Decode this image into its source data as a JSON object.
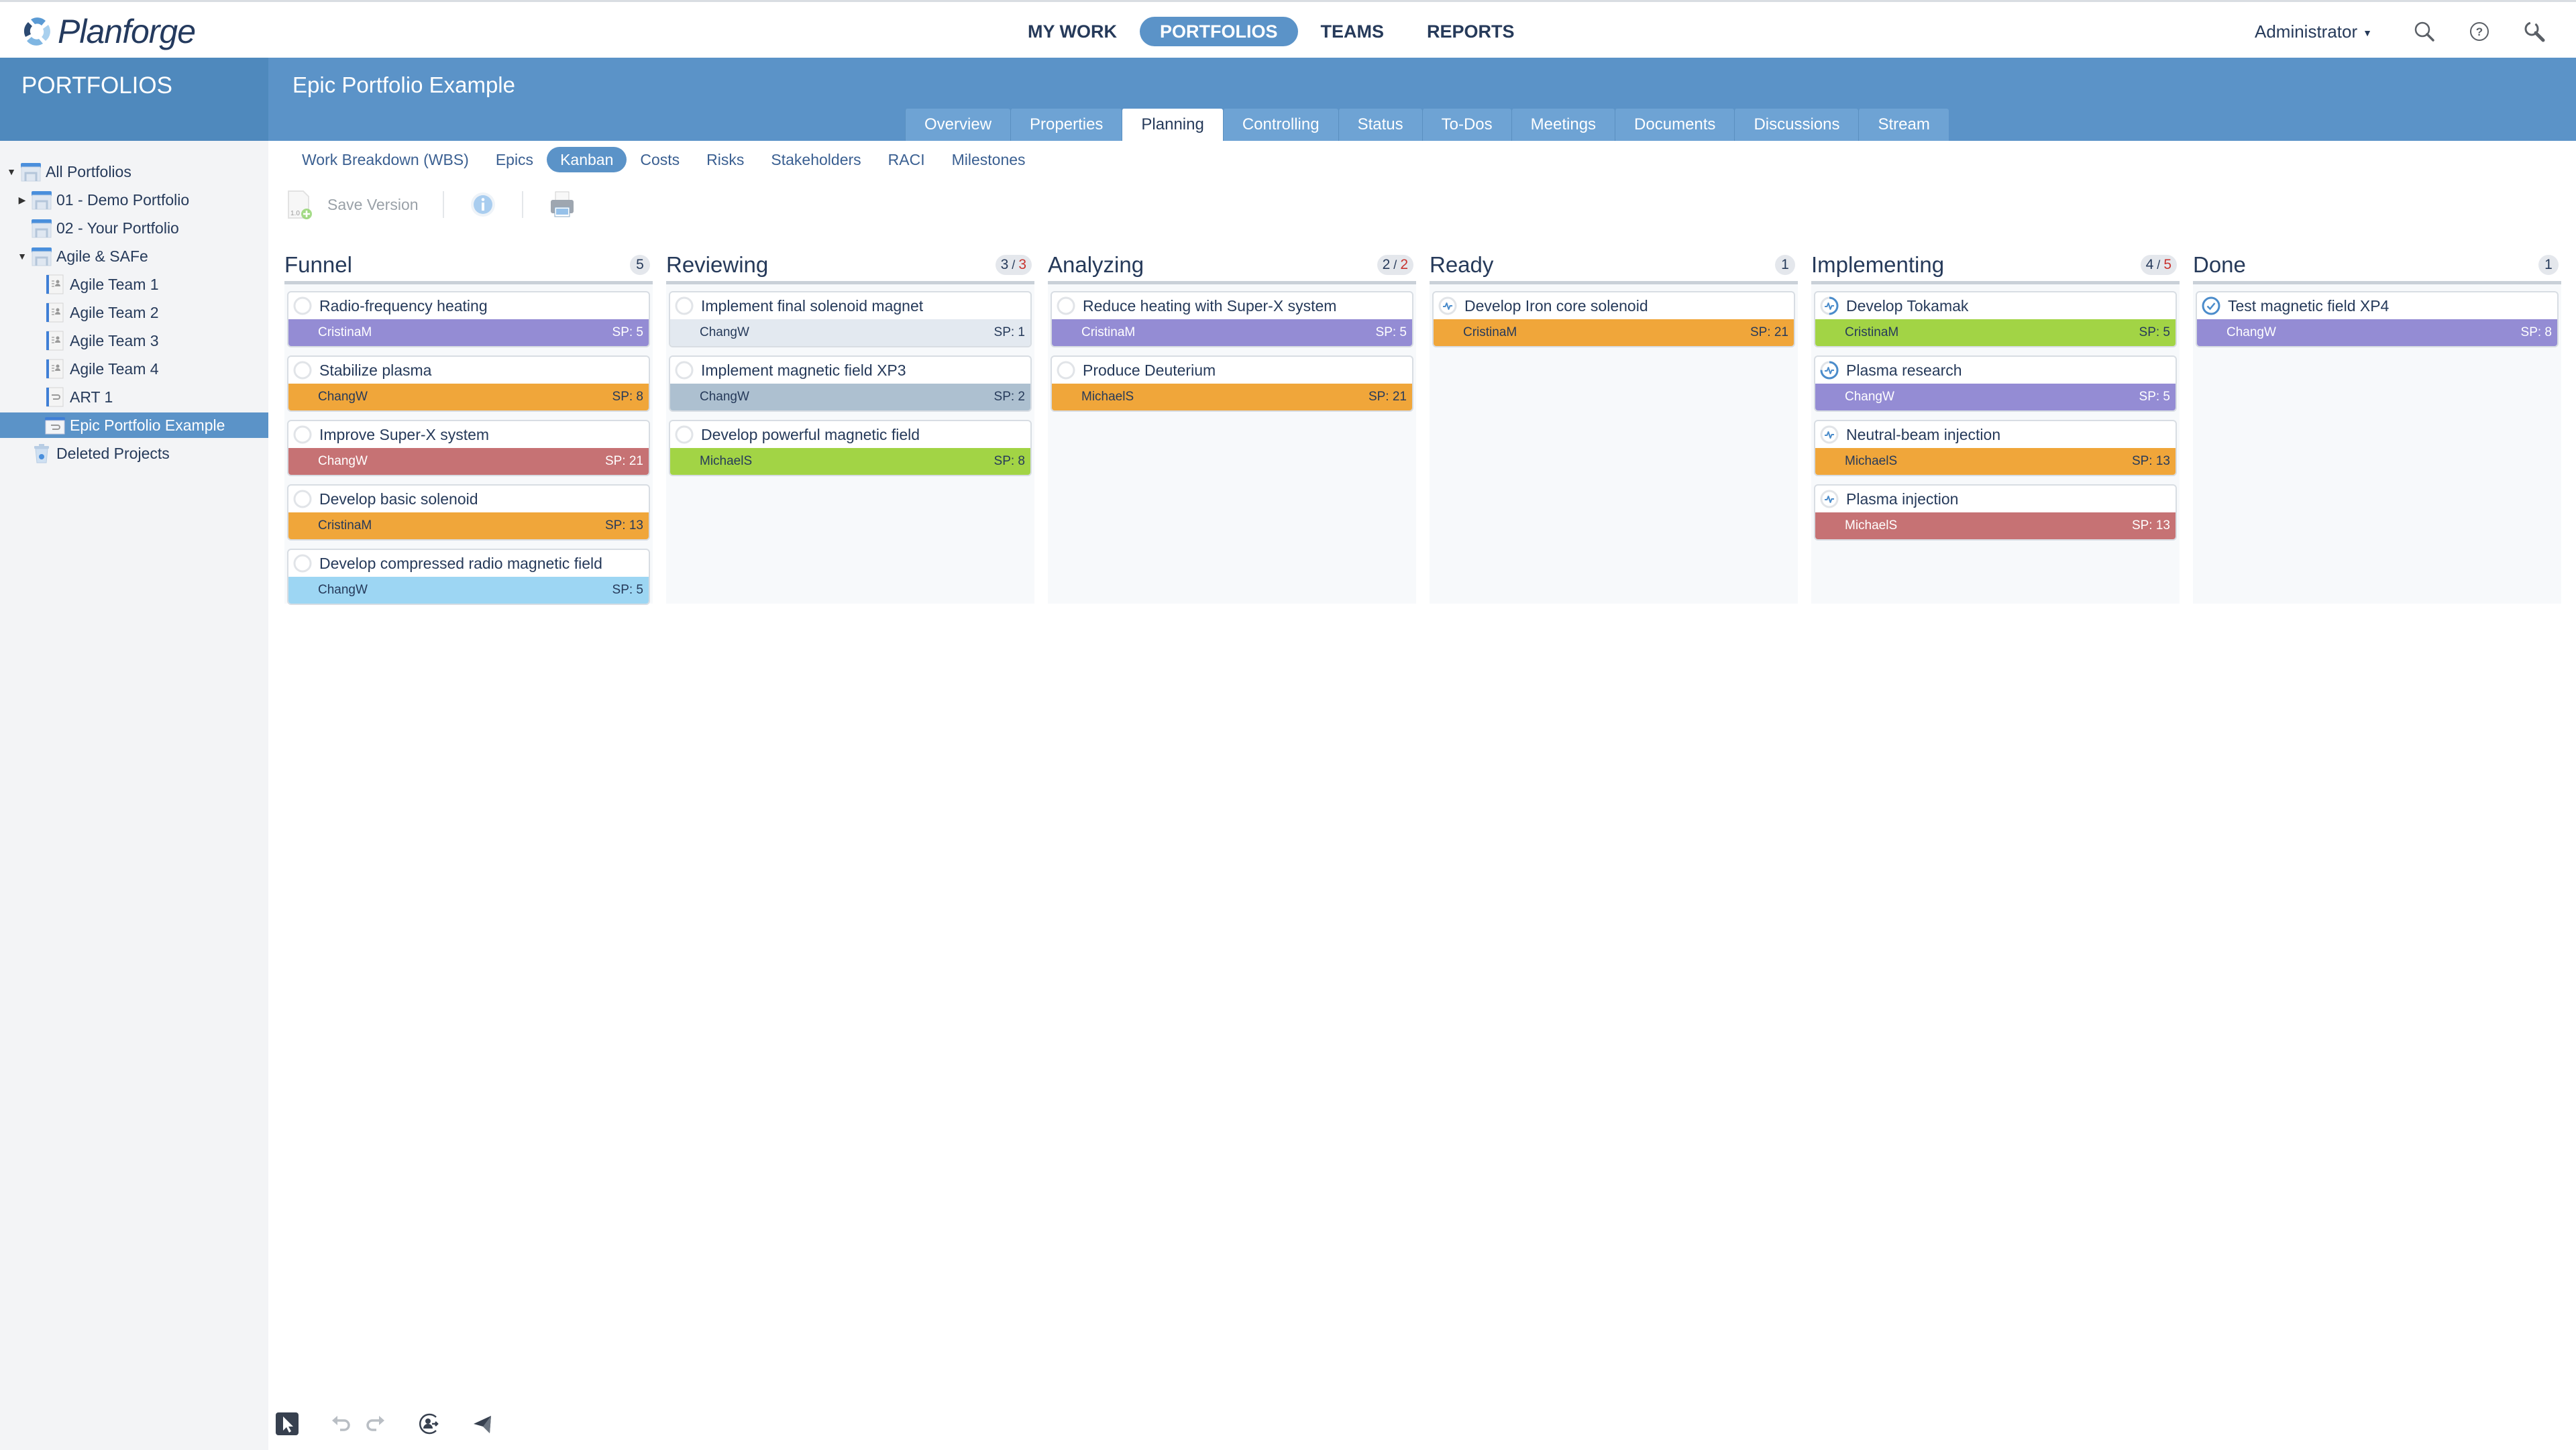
{
  "app": {
    "logo_text": "Planforge",
    "nav": [
      {
        "label": "MY WORK",
        "active": false
      },
      {
        "label": "PORTFOLIOS",
        "active": true
      },
      {
        "label": "TEAMS",
        "active": false
      },
      {
        "label": "REPORTS",
        "active": false
      }
    ],
    "user_label": "Administrator",
    "icons": [
      "search-icon",
      "help-icon",
      "settings-wrench-icon"
    ]
  },
  "sidebar": {
    "title": "PORTFOLIOS",
    "items": [
      {
        "label": "All Portfolios",
        "level": 0,
        "toggle": "expanded",
        "icon": "portfolio-folder-icon",
        "selected": false
      },
      {
        "label": "01 - Demo Portfolio",
        "level": 1,
        "toggle": "collapsed",
        "icon": "portfolio-folder-icon",
        "selected": false
      },
      {
        "label": "02 - Your Portfolio",
        "level": 1,
        "toggle": "none",
        "icon": "portfolio-folder-icon",
        "selected": false
      },
      {
        "label": "Agile & SAFe",
        "level": 1,
        "toggle": "expanded",
        "icon": "portfolio-folder-icon",
        "selected": false
      },
      {
        "label": "Agile Team 1",
        "level": 2,
        "toggle": "none",
        "icon": "team-project-icon",
        "selected": false
      },
      {
        "label": "Agile Team 2",
        "level": 2,
        "toggle": "none",
        "icon": "team-project-icon",
        "selected": false
      },
      {
        "label": "Agile Team 3",
        "level": 2,
        "toggle": "none",
        "icon": "team-project-icon",
        "selected": false
      },
      {
        "label": "Agile Team 4",
        "level": 2,
        "toggle": "none",
        "icon": "team-project-icon",
        "selected": false
      },
      {
        "label": "ART 1",
        "level": 2,
        "toggle": "none",
        "icon": "art-project-icon",
        "selected": false
      },
      {
        "label": "Epic Portfolio Example",
        "level": 2,
        "toggle": "none",
        "icon": "epic-portfolio-icon",
        "selected": true
      },
      {
        "label": "Deleted Projects",
        "level": 1,
        "toggle": "none",
        "icon": "trash-icon",
        "selected": false
      }
    ]
  },
  "project": {
    "title": "Epic Portfolio Example",
    "tabs": [
      {
        "label": "Overview",
        "active": false
      },
      {
        "label": "Properties",
        "active": false
      },
      {
        "label": "Planning",
        "active": true
      },
      {
        "label": "Controlling",
        "active": false
      },
      {
        "label": "Status",
        "active": false
      },
      {
        "label": "To-Dos",
        "active": false
      },
      {
        "label": "Meetings",
        "active": false
      },
      {
        "label": "Documents",
        "active": false
      },
      {
        "label": "Discussions",
        "active": false
      },
      {
        "label": "Stream",
        "active": false
      }
    ],
    "subtabs": [
      {
        "label": "Work Breakdown (WBS)",
        "active": false
      },
      {
        "label": "Epics",
        "active": false
      },
      {
        "label": "Kanban",
        "active": true
      },
      {
        "label": "Costs",
        "active": false
      },
      {
        "label": "Risks",
        "active": false
      },
      {
        "label": "Stakeholders",
        "active": false
      },
      {
        "label": "RACI",
        "active": false
      },
      {
        "label": "Milestones",
        "active": false
      }
    ],
    "toolbar": {
      "save_version_label": "Save Version",
      "icons": [
        "save-version-icon",
        "info-icon",
        "print-icon"
      ]
    }
  },
  "colors": {
    "purple": {
      "bg": "#948cd4",
      "fg": "#ffffff"
    },
    "orange": {
      "bg": "#f0a63a",
      "fg": "#263a5a"
    },
    "red": {
      "bg": "#c67274",
      "fg": "#ffffff"
    },
    "lightblue": {
      "bg": "#9dd6f3",
      "fg": "#263a5a"
    },
    "pale": {
      "bg": "#e3e9f0",
      "fg": "#263a5a"
    },
    "slate": {
      "bg": "#adc0d0",
      "fg": "#263a5a"
    },
    "green": {
      "bg": "#a2d445",
      "fg": "#263a5a"
    },
    "accent": "#5b93c8",
    "limit_red": "#c8332f"
  },
  "kanban": {
    "columns": [
      {
        "title": "Funnel",
        "count": "5",
        "limit": null,
        "cards": [
          {
            "title": "Radio-frequency heating",
            "assignee": "CristinaM",
            "sp": "SP: 5",
            "color": "purple",
            "status": "not-started",
            "progress": 0
          },
          {
            "title": "Stabilize plasma",
            "assignee": "ChangW",
            "sp": "SP: 8",
            "color": "orange",
            "status": "not-started",
            "progress": 0
          },
          {
            "title": "Improve Super-X system",
            "assignee": "ChangW",
            "sp": "SP: 21",
            "color": "red",
            "status": "not-started",
            "progress": 0
          },
          {
            "title": "Develop basic solenoid",
            "assignee": "CristinaM",
            "sp": "SP: 13",
            "color": "orange",
            "status": "not-started",
            "progress": 0
          },
          {
            "title": "Develop compressed radio magnetic field",
            "assignee": "ChangW",
            "sp": "SP: 5",
            "color": "lightblue",
            "status": "not-started",
            "progress": 0
          }
        ]
      },
      {
        "title": "Reviewing",
        "count": "3",
        "limit": "3",
        "cards": [
          {
            "title": "Implement final solenoid magnet",
            "assignee": "ChangW",
            "sp": "SP: 1",
            "color": "pale",
            "status": "not-started",
            "progress": 0
          },
          {
            "title": "Implement magnetic field XP3",
            "assignee": "ChangW",
            "sp": "SP: 2",
            "color": "slate",
            "status": "not-started",
            "progress": 0
          },
          {
            "title": "Develop powerful magnetic field",
            "assignee": "MichaelS",
            "sp": "SP: 8",
            "color": "green",
            "status": "not-started",
            "progress": 0
          }
        ]
      },
      {
        "title": "Analyzing",
        "count": "2",
        "limit": "2",
        "cards": [
          {
            "title": "Reduce heating with Super-X system",
            "assignee": "CristinaM",
            "sp": "SP: 5",
            "color": "purple",
            "status": "not-started",
            "progress": 0
          },
          {
            "title": "Produce Deuterium",
            "assignee": "MichaelS",
            "sp": "SP: 21",
            "color": "orange",
            "status": "not-started",
            "progress": 0
          }
        ]
      },
      {
        "title": "Ready",
        "count": "1",
        "limit": null,
        "cards": [
          {
            "title": "Develop Iron core solenoid",
            "assignee": "CristinaM",
            "sp": "SP: 21",
            "color": "orange",
            "status": "in-progress",
            "progress": 0
          }
        ]
      },
      {
        "title": "Implementing",
        "count": "4",
        "limit": "5",
        "cards": [
          {
            "title": "Develop Tokamak",
            "assignee": "CristinaM",
            "sp": "SP: 5",
            "color": "green",
            "status": "in-progress",
            "progress": 0.5
          },
          {
            "title": "Plasma research",
            "assignee": "ChangW",
            "sp": "SP: 5",
            "color": "purple",
            "status": "in-progress",
            "progress": 0.75
          },
          {
            "title": "Neutral-beam injection",
            "assignee": "MichaelS",
            "sp": "SP: 13",
            "color": "orange",
            "status": "in-progress",
            "progress": 0
          },
          {
            "title": "Plasma injection",
            "assignee": "MichaelS",
            "sp": "SP: 13",
            "color": "red",
            "status": "in-progress",
            "progress": 0
          }
        ]
      },
      {
        "title": "Done",
        "count": "1",
        "limit": null,
        "cards": [
          {
            "title": "Test magnetic field XP4",
            "assignee": "ChangW",
            "sp": "SP: 8",
            "color": "purple",
            "status": "done",
            "progress": 1
          }
        ]
      }
    ]
  },
  "bottom_toolbar": {
    "icons": [
      "pointer-select-icon",
      "undo-icon",
      "redo-icon",
      "user-switch-icon",
      "send-icon"
    ]
  }
}
